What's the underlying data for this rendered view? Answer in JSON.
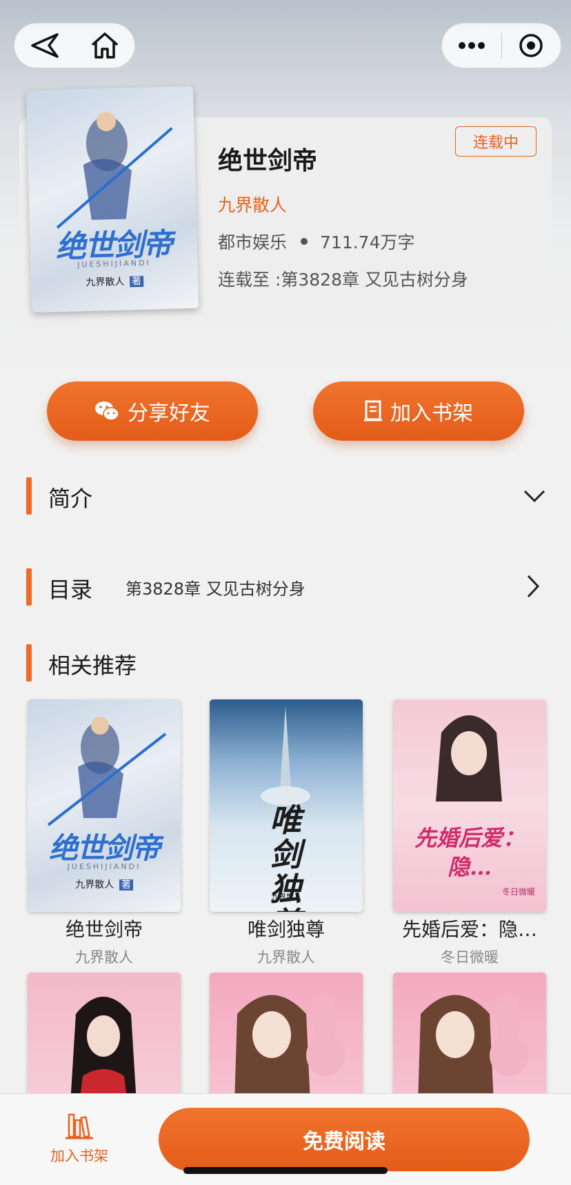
{
  "book": {
    "title": "绝世剑帝",
    "author": "九界散人",
    "category": "都市娱乐",
    "word_count": "711.74万字",
    "latest": "连载至 :第3828章 又见古树分身",
    "status": "连载中",
    "cover": {
      "title": "绝世剑帝",
      "pinyin": "JUESHIJIANDI",
      "author": "九界散人",
      "author_tag": "著"
    }
  },
  "actions": {
    "share_label": "分享好友",
    "shelf_label": "加入书架"
  },
  "sections": {
    "intro": "简介",
    "toc": "目录",
    "toc_latest": "第3828章 又见古树分身",
    "recommend": "相关推荐"
  },
  "recommendations": [
    {
      "name": "绝世剑帝",
      "author": "九界散人"
    },
    {
      "name": "唯剑独尊",
      "author": "九界散人"
    },
    {
      "name": "先婚后爱：隐…",
      "author": "冬日微暖"
    }
  ],
  "bottom": {
    "shelf_label": "加入书架",
    "read_label": "免费阅读"
  },
  "colors": {
    "accent": "#e8621e",
    "button": "#e35c18"
  },
  "icons": [
    "back-arrow-icon",
    "home-icon",
    "more-icon",
    "target-icon",
    "wechat-icon",
    "bookshelf-icon",
    "chevron-down-icon",
    "chevron-right-icon"
  ]
}
